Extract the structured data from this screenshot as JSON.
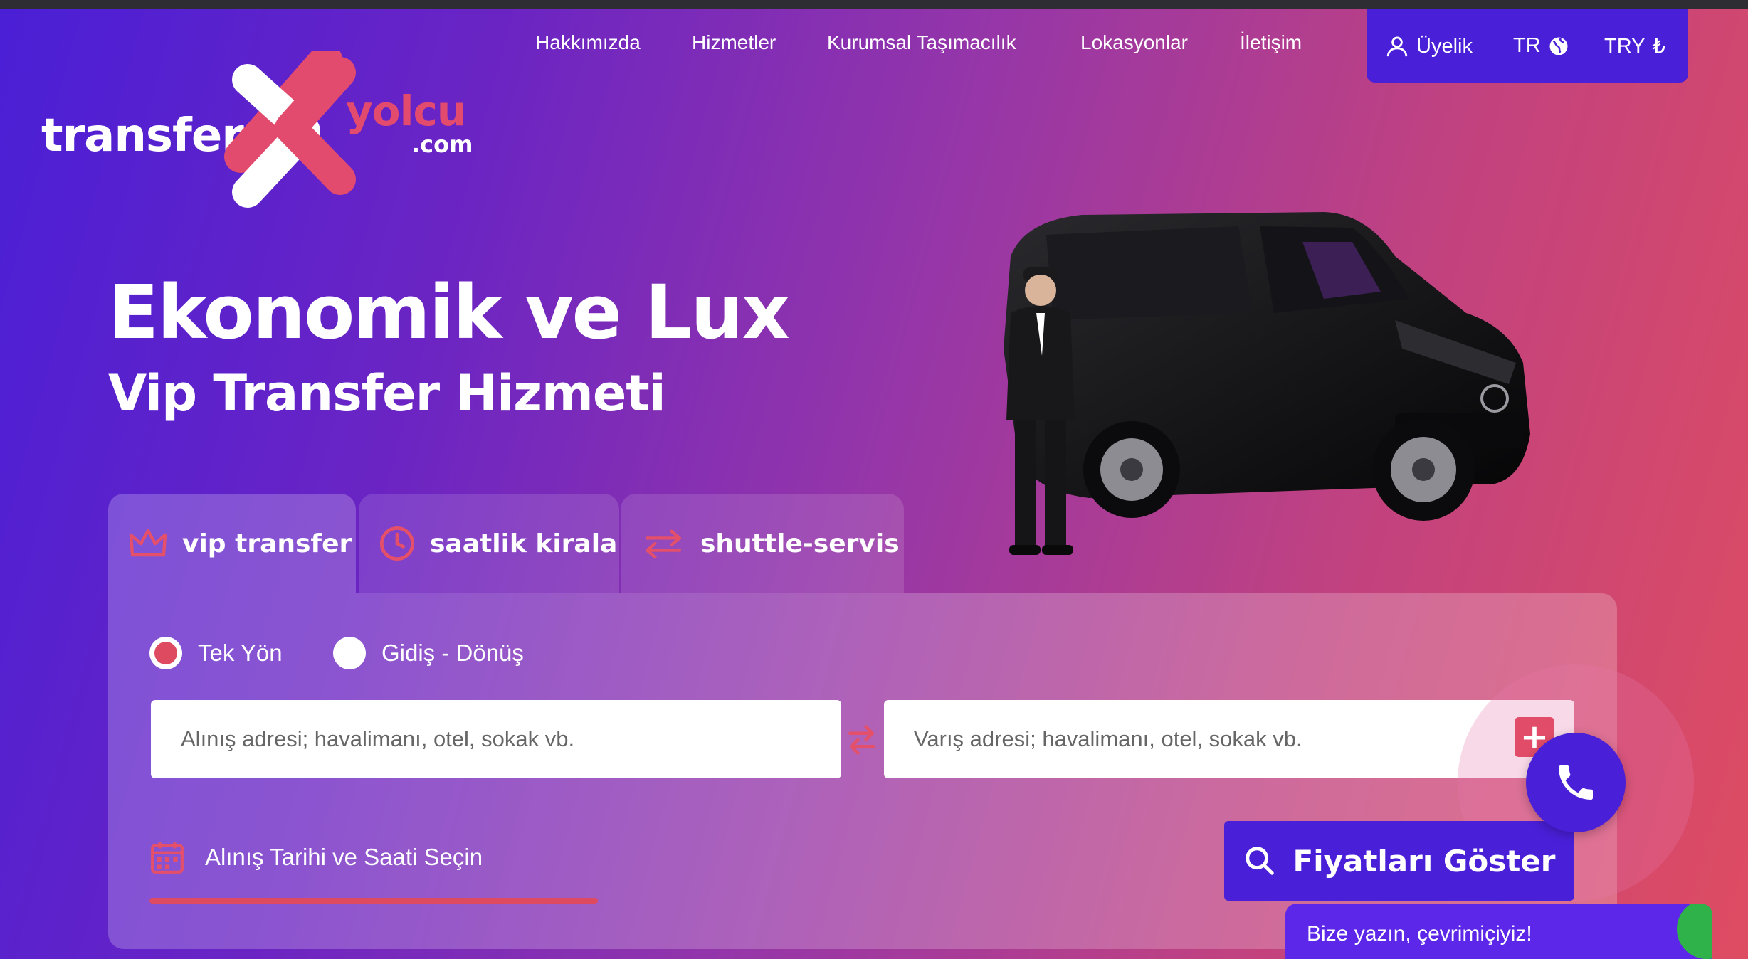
{
  "brand": {
    "part1": "transfer",
    "part2": "yolcu",
    "part3": ".com"
  },
  "nav": [
    {
      "label": "Hakkımızda"
    },
    {
      "label": "Hizmetler"
    },
    {
      "label": "Kurumsal Taşımacılık"
    },
    {
      "label": "Lokasyonlar"
    },
    {
      "label": "İletişim"
    }
  ],
  "account": {
    "member_label": "Üyelik",
    "language": "TR",
    "currency": "TRY",
    "currency_symbol": "₺"
  },
  "hero": {
    "line1": "Ekonomik ve Lux",
    "line2": "Vip Transfer Hizmeti"
  },
  "tabs": [
    {
      "label": "vip transfer",
      "icon": "crown-icon",
      "active": true
    },
    {
      "label": "saatlik kirala",
      "icon": "clock-icon",
      "active": false
    },
    {
      "label": "shuttle-servis",
      "icon": "swap-arrows-icon",
      "active": false
    }
  ],
  "trip_type": {
    "one_way": "Tek Yön",
    "round_trip": "Gidiş - Dönüş",
    "selected": "one_way"
  },
  "pickup": {
    "placeholder": "Alınış adresi; havalimanı, otel, sokak vb."
  },
  "dropoff": {
    "placeholder": "Varış adresi; havalimanı, otel, sokak vb."
  },
  "date_picker": {
    "label": "Alınış Tarihi ve Saati Seçin"
  },
  "search_button": {
    "label": "Fiyatları Göster"
  },
  "chat": {
    "label": "Bize yazın, çevrimiçiyiz!"
  },
  "colors": {
    "accent_blue": "#4a1fd8",
    "accent_red": "#de4a60",
    "gradient_start": "#4a1fd6",
    "gradient_end": "#de4c61"
  }
}
